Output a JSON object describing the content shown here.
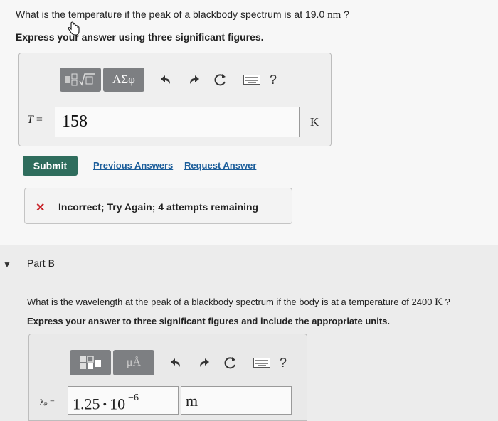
{
  "partA": {
    "question_prefix": "What is the temperature if the peak of a blackbody spectrum is at 19.0 ",
    "question_unit": "nm",
    "question_suffix": " ?",
    "instruction": "Express your answer using three significant figures.",
    "toolbar": {
      "greek_label": "ΑΣφ",
      "help_label": "?",
      "undo_icon": "undo-arrow-icon",
      "redo_icon": "redo-arrow-icon",
      "reset_icon": "reset-icon",
      "keyboard_icon": "keyboard-icon",
      "templates_icon": "templates-icon"
    },
    "variable_label": "T",
    "equals": "=",
    "input_value": "158",
    "unit_label": "K",
    "submit_label": "Submit",
    "previous_answers_label": "Previous Answers",
    "request_answer_label": "Request Answer",
    "feedback_icon": "x-icon",
    "feedback_text": "Incorrect; Try Again; 4 attempts remaining"
  },
  "partB": {
    "label": "Part B",
    "question_prefix": "What is the wavelength at the peak of a blackbody spectrum if the body is at a temperature of 2400 ",
    "question_unit": "K",
    "question_suffix": " ?",
    "instruction": "Express your answer to three significant figures and include the appropriate units.",
    "toolbar": {
      "units_label": "μÅ",
      "help_label": "?"
    },
    "variable_label": "λₚ",
    "equals": "=",
    "value_mantissa": "1.25",
    "value_times": "•",
    "value_base": "10",
    "value_exponent": "−6",
    "unit_value": "m"
  },
  "colors": {
    "submit_bg": "#2f6d5d",
    "link": "#1b5d9a",
    "error": "#c8252b",
    "toolbar_dark": "#7d7f82"
  }
}
